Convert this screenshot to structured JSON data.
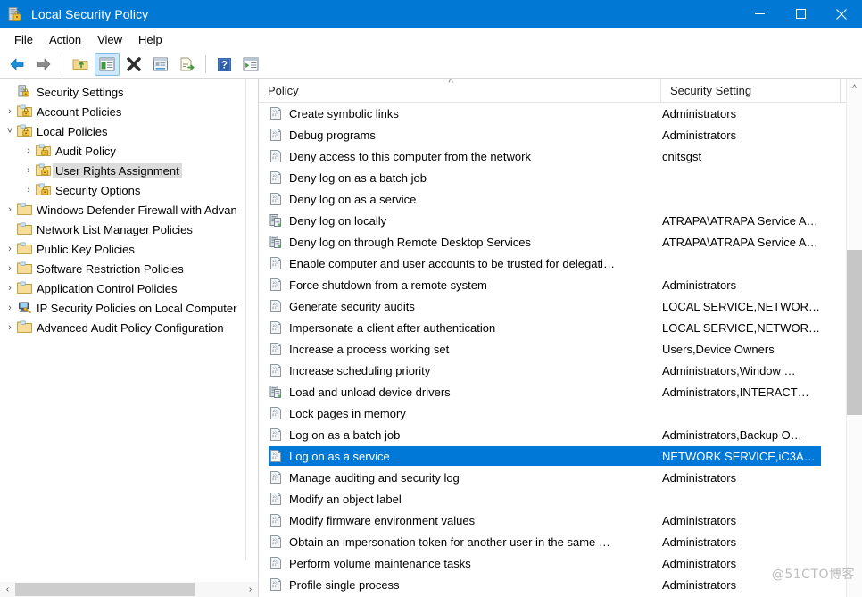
{
  "window": {
    "title": "Local Security Policy",
    "icon": "security-policy-icon",
    "accent_color": "#0078d4",
    "selection_color": "#0078d7",
    "controls": [
      {
        "name": "minimize",
        "glyph": "minimize-icon"
      },
      {
        "name": "maximize",
        "glyph": "maximize-icon"
      },
      {
        "name": "close",
        "glyph": "close-icon"
      }
    ]
  },
  "menubar": {
    "items": [
      {
        "label": "File"
      },
      {
        "label": "Action"
      },
      {
        "label": "View"
      },
      {
        "label": "Help"
      }
    ]
  },
  "toolbar": {
    "buttons": [
      {
        "name": "back-icon",
        "active": false
      },
      {
        "name": "forward-icon",
        "active": false
      },
      {
        "name": "up-one-level-icon",
        "active": false
      },
      {
        "name": "show-hide-console-tree-icon",
        "active": true
      },
      {
        "name": "delete-icon",
        "active": false
      },
      {
        "name": "properties-icon",
        "active": false
      },
      {
        "name": "export-list-icon",
        "active": false
      },
      {
        "name": "help-icon",
        "active": false
      },
      {
        "name": "show-hide-action-pane-icon",
        "active": false
      }
    ]
  },
  "sidebar": {
    "items": [
      {
        "label": "Security Settings",
        "level": 0,
        "twisty": "",
        "icon": "security-settings-icon",
        "selected": false
      },
      {
        "label": "Account Policies",
        "level": 1,
        "twisty": "›",
        "icon": "policy-folder-icon",
        "selected": false
      },
      {
        "label": "Local Policies",
        "level": 1,
        "twisty": "˅",
        "icon": "policy-folder-icon",
        "selected": false
      },
      {
        "label": "Audit Policy",
        "level": 2,
        "twisty": "›",
        "icon": "policy-folder-icon",
        "selected": false
      },
      {
        "label": "User Rights Assignment",
        "level": 2,
        "twisty": "›",
        "icon": "policy-folder-icon",
        "selected": true
      },
      {
        "label": "Security Options",
        "level": 2,
        "twisty": "›",
        "icon": "policy-folder-icon",
        "selected": false
      },
      {
        "label": "Windows Defender Firewall with Advan",
        "level": 1,
        "twisty": "›",
        "icon": "folder-icon",
        "selected": false
      },
      {
        "label": "Network List Manager Policies",
        "level": 1,
        "twisty": "",
        "icon": "folder-icon",
        "selected": false
      },
      {
        "label": "Public Key Policies",
        "level": 1,
        "twisty": "›",
        "icon": "folder-icon",
        "selected": false
      },
      {
        "label": "Software Restriction Policies",
        "level": 1,
        "twisty": "›",
        "icon": "folder-icon",
        "selected": false
      },
      {
        "label": "Application Control Policies",
        "level": 1,
        "twisty": "›",
        "icon": "folder-icon",
        "selected": false
      },
      {
        "label": "IP Security Policies on Local Computer",
        "level": 1,
        "twisty": "›",
        "icon": "ip-security-icon",
        "selected": false
      },
      {
        "label": "Advanced Audit Policy Configuration",
        "level": 1,
        "twisty": "›",
        "icon": "folder-icon",
        "selected": false
      }
    ],
    "h_scroll": {
      "left_arrow": "‹",
      "right_arrow": "›"
    }
  },
  "list": {
    "columns": [
      {
        "label": "Policy",
        "sort": "ascending",
        "sort_glyph": "˄"
      },
      {
        "label": "Security Setting"
      }
    ],
    "rows": [
      {
        "policy": "Create symbolic links",
        "setting": "Administrators",
        "icon": "policy-doc-icon",
        "selected": false
      },
      {
        "policy": "Debug programs",
        "setting": "Administrators",
        "icon": "policy-doc-icon",
        "selected": false
      },
      {
        "policy": "Deny access to this computer from the network",
        "setting": "cnitsgst",
        "icon": "policy-doc-icon",
        "selected": false
      },
      {
        "policy": "Deny log on as a batch job",
        "setting": "",
        "icon": "policy-doc-icon",
        "selected": false
      },
      {
        "policy": "Deny log on as a service",
        "setting": "",
        "icon": "policy-doc-icon",
        "selected": false
      },
      {
        "policy": "Deny log on locally",
        "setting": "ATRAPA\\ATRAPA Service A…",
        "icon": "policy-server-icon",
        "selected": false
      },
      {
        "policy": "Deny log on through Remote Desktop Services",
        "setting": "ATRAPA\\ATRAPA Service A…",
        "icon": "policy-server-icon",
        "selected": false
      },
      {
        "policy": "Enable computer and user accounts to be trusted for delegati…",
        "setting": "",
        "icon": "policy-doc-icon",
        "selected": false
      },
      {
        "policy": "Force shutdown from a remote system",
        "setting": "Administrators",
        "icon": "policy-doc-icon",
        "selected": false
      },
      {
        "policy": "Generate security audits",
        "setting": "LOCAL SERVICE,NETWOR…",
        "icon": "policy-doc-icon",
        "selected": false
      },
      {
        "policy": "Impersonate a client after authentication",
        "setting": "LOCAL SERVICE,NETWOR…",
        "icon": "policy-doc-icon",
        "selected": false
      },
      {
        "policy": "Increase a process working set",
        "setting": "Users,Device Owners",
        "icon": "policy-doc-icon",
        "selected": false
      },
      {
        "policy": "Increase scheduling priority",
        "setting": "Administrators,Window …",
        "icon": "policy-doc-icon",
        "selected": false
      },
      {
        "policy": "Load and unload device drivers",
        "setting": "Administrators,INTERACT…",
        "icon": "policy-server-icon",
        "selected": false
      },
      {
        "policy": "Lock pages in memory",
        "setting": "",
        "icon": "policy-doc-icon",
        "selected": false
      },
      {
        "policy": "Log on as a batch job",
        "setting": "Administrators,Backup O…",
        "icon": "policy-doc-icon",
        "selected": false
      },
      {
        "policy": "Log on as a service",
        "setting": "NETWORK SERVICE,iC3A…",
        "icon": "policy-doc-icon",
        "selected": true
      },
      {
        "policy": "Manage auditing and security log",
        "setting": "Administrators",
        "icon": "policy-doc-icon",
        "selected": false
      },
      {
        "policy": "Modify an object label",
        "setting": "",
        "icon": "policy-doc-icon",
        "selected": false
      },
      {
        "policy": "Modify firmware environment values",
        "setting": "Administrators",
        "icon": "policy-doc-icon",
        "selected": false
      },
      {
        "policy": "Obtain an impersonation token for another user in the same …",
        "setting": "Administrators",
        "icon": "policy-doc-icon",
        "selected": false
      },
      {
        "policy": "Perform volume maintenance tasks",
        "setting": "Administrators",
        "icon": "policy-doc-icon",
        "selected": false
      },
      {
        "policy": "Profile single process",
        "setting": "Administrators",
        "icon": "policy-doc-icon",
        "selected": false
      }
    ],
    "v_scroll": {
      "up_arrow": "˄"
    }
  },
  "watermark": {
    "text": "@51CTO博客"
  }
}
